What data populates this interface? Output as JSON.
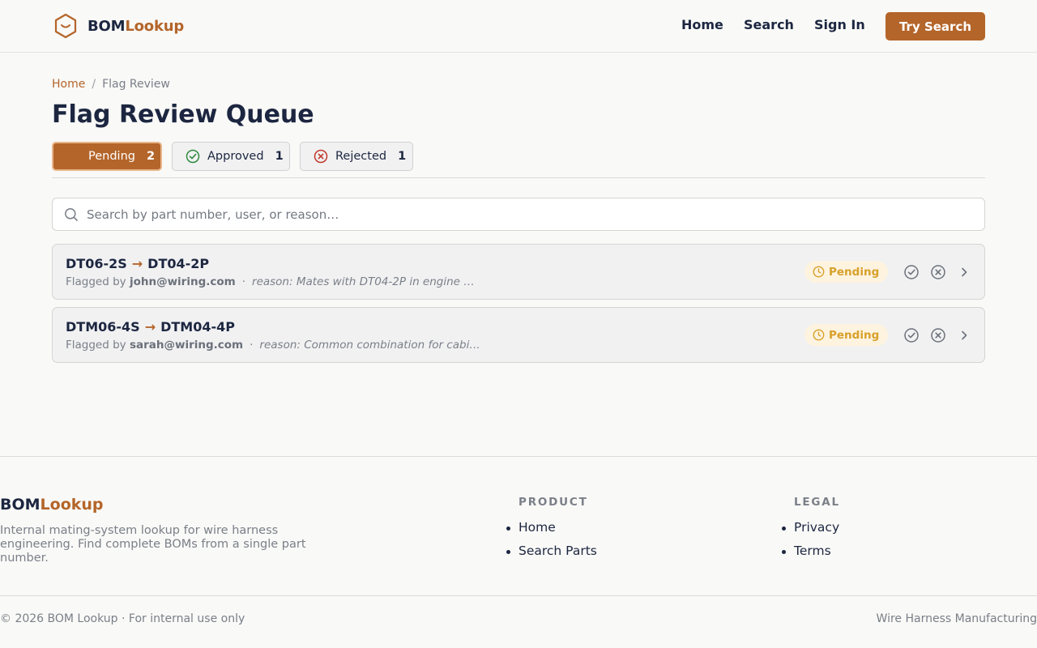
{
  "header": {
    "brand_part1": "BOM",
    "brand_part2": "Lookup",
    "nav": {
      "home": "Home",
      "search": "Search",
      "sign_in": "Sign In"
    },
    "cta_label": "Try Search"
  },
  "breadcrumb": {
    "home": "Home",
    "separator": "/",
    "current": "Flag Review"
  },
  "page_title": "Flag Review Queue",
  "tabs": [
    {
      "label": "Pending",
      "count": "2",
      "icon": "clock-icon",
      "active": true
    },
    {
      "label": "Approved",
      "count": "1",
      "icon": "check-circle-icon",
      "active": false
    },
    {
      "label": "Rejected",
      "count": "1",
      "icon": "x-circle-icon",
      "active": false
    }
  ],
  "search": {
    "placeholder": "Search by part number, user, or reason…",
    "value": ""
  },
  "flags": [
    {
      "from": "DT06-2S",
      "arrow": "→",
      "to": "DT04-2P",
      "flagged_by_label": "Flagged by",
      "user": "john@wiring.com",
      "separator": "·",
      "reason": "reason: Mates with DT04-2P in engine …",
      "status": "Pending"
    },
    {
      "from": "DTM06-4S",
      "arrow": "→",
      "to": "DTM04-4P",
      "flagged_by_label": "Flagged by",
      "user": "sarah@wiring.com",
      "separator": "·",
      "reason": "reason: Common combination for cabi…",
      "status": "Pending"
    }
  ],
  "footer": {
    "brand_part1": "BOM",
    "brand_part2": "Lookup",
    "description": "Internal mating-system lookup for wire harness engineering. Find complete BOMs from a single part number.",
    "product": {
      "heading": "PRODUCT",
      "links": [
        "Home",
        "Search Parts"
      ]
    },
    "legal": {
      "heading": "LEGAL",
      "links": [
        "Privacy",
        "Terms"
      ]
    },
    "copyright": "© 2026 BOM Lookup · For internal use only",
    "tagline": "Wire Harness Manufacturing"
  },
  "colors": {
    "accent": "#b4652a",
    "navy": "#1c2640",
    "pending": "#d8a02a",
    "approved": "#2f8a3e",
    "rejected": "#c0392b"
  }
}
